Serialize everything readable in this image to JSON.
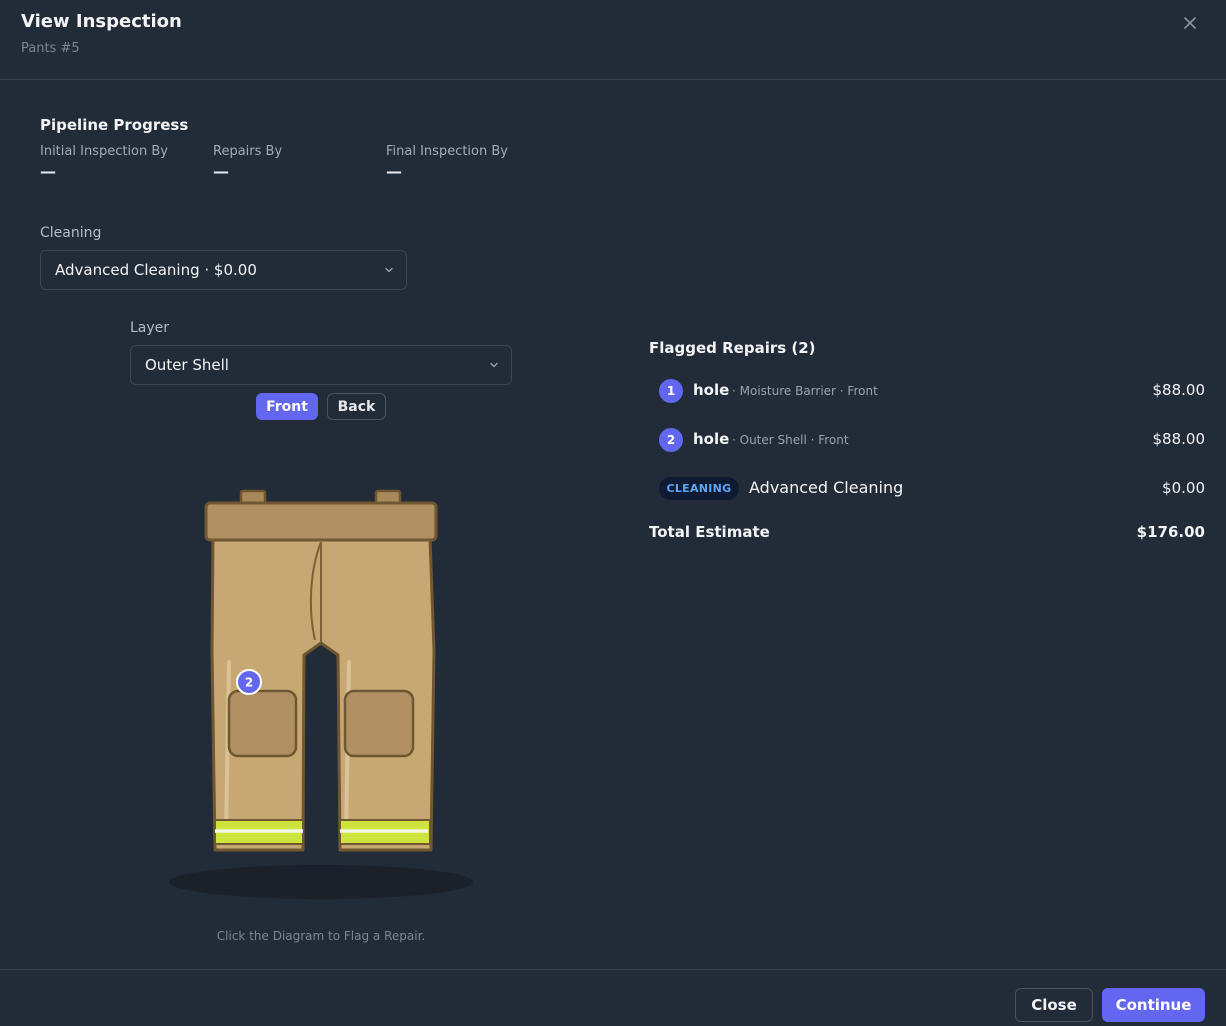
{
  "header": {
    "title": "View Inspection",
    "subtitle": "Pants #5"
  },
  "pipeline": {
    "title": "Pipeline Progress",
    "steps": [
      {
        "label": "Initial Inspection By",
        "value": "—"
      },
      {
        "label": "Repairs By",
        "value": "—"
      },
      {
        "label": "Final Inspection By",
        "value": "—"
      }
    ]
  },
  "cleaning": {
    "label": "Cleaning",
    "selected": "Advanced Cleaning · $0.00"
  },
  "layer": {
    "label": "Layer",
    "selected": "Outer Shell"
  },
  "view_toggle": {
    "front_label": "Front",
    "back_label": "Back",
    "active": "Front"
  },
  "diagram": {
    "marker_number": "2",
    "hint": "Click the Diagram to Flag a Repair."
  },
  "flagged": {
    "title": "Flagged Repairs (2)",
    "items": [
      {
        "number": "1",
        "type": "hole",
        "detail": "· Moisture Barrier · Front",
        "price": "$88.00"
      },
      {
        "number": "2",
        "type": "hole",
        "detail": "· Outer Shell · Front",
        "price": "$88.00"
      }
    ],
    "cleaning_item": {
      "badge": "CLEANING",
      "name": "Advanced Cleaning",
      "price": "$0.00"
    },
    "total_label": "Total Estimate",
    "total_value": "$176.00"
  },
  "footer": {
    "close_label": "Close",
    "continue_label": "Continue"
  },
  "colors": {
    "background": "#222b38",
    "accent": "#6366f1",
    "cleaning_badge_text": "#60a5fa",
    "reflective_stripe": "#d4f03a",
    "fabric_tan": "#c8a872"
  }
}
